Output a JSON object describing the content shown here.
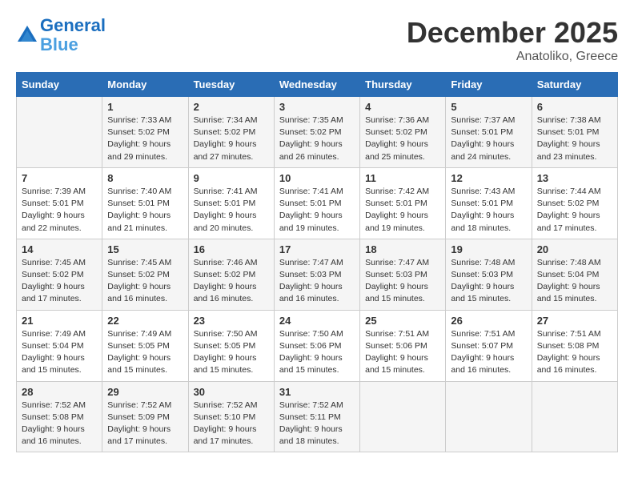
{
  "header": {
    "logo_line1": "General",
    "logo_line2": "Blue",
    "month": "December 2025",
    "location": "Anatoliko, Greece"
  },
  "days_of_week": [
    "Sunday",
    "Monday",
    "Tuesday",
    "Wednesday",
    "Thursday",
    "Friday",
    "Saturday"
  ],
  "weeks": [
    [
      {
        "day": "",
        "info": ""
      },
      {
        "day": "1",
        "info": "Sunrise: 7:33 AM\nSunset: 5:02 PM\nDaylight: 9 hours\nand 29 minutes."
      },
      {
        "day": "2",
        "info": "Sunrise: 7:34 AM\nSunset: 5:02 PM\nDaylight: 9 hours\nand 27 minutes."
      },
      {
        "day": "3",
        "info": "Sunrise: 7:35 AM\nSunset: 5:02 PM\nDaylight: 9 hours\nand 26 minutes."
      },
      {
        "day": "4",
        "info": "Sunrise: 7:36 AM\nSunset: 5:02 PM\nDaylight: 9 hours\nand 25 minutes."
      },
      {
        "day": "5",
        "info": "Sunrise: 7:37 AM\nSunset: 5:01 PM\nDaylight: 9 hours\nand 24 minutes."
      },
      {
        "day": "6",
        "info": "Sunrise: 7:38 AM\nSunset: 5:01 PM\nDaylight: 9 hours\nand 23 minutes."
      }
    ],
    [
      {
        "day": "7",
        "info": "Sunrise: 7:39 AM\nSunset: 5:01 PM\nDaylight: 9 hours\nand 22 minutes."
      },
      {
        "day": "8",
        "info": "Sunrise: 7:40 AM\nSunset: 5:01 PM\nDaylight: 9 hours\nand 21 minutes."
      },
      {
        "day": "9",
        "info": "Sunrise: 7:41 AM\nSunset: 5:01 PM\nDaylight: 9 hours\nand 20 minutes."
      },
      {
        "day": "10",
        "info": "Sunrise: 7:41 AM\nSunset: 5:01 PM\nDaylight: 9 hours\nand 19 minutes."
      },
      {
        "day": "11",
        "info": "Sunrise: 7:42 AM\nSunset: 5:01 PM\nDaylight: 9 hours\nand 19 minutes."
      },
      {
        "day": "12",
        "info": "Sunrise: 7:43 AM\nSunset: 5:01 PM\nDaylight: 9 hours\nand 18 minutes."
      },
      {
        "day": "13",
        "info": "Sunrise: 7:44 AM\nSunset: 5:02 PM\nDaylight: 9 hours\nand 17 minutes."
      }
    ],
    [
      {
        "day": "14",
        "info": "Sunrise: 7:45 AM\nSunset: 5:02 PM\nDaylight: 9 hours\nand 17 minutes."
      },
      {
        "day": "15",
        "info": "Sunrise: 7:45 AM\nSunset: 5:02 PM\nDaylight: 9 hours\nand 16 minutes."
      },
      {
        "day": "16",
        "info": "Sunrise: 7:46 AM\nSunset: 5:02 PM\nDaylight: 9 hours\nand 16 minutes."
      },
      {
        "day": "17",
        "info": "Sunrise: 7:47 AM\nSunset: 5:03 PM\nDaylight: 9 hours\nand 16 minutes."
      },
      {
        "day": "18",
        "info": "Sunrise: 7:47 AM\nSunset: 5:03 PM\nDaylight: 9 hours\nand 15 minutes."
      },
      {
        "day": "19",
        "info": "Sunrise: 7:48 AM\nSunset: 5:03 PM\nDaylight: 9 hours\nand 15 minutes."
      },
      {
        "day": "20",
        "info": "Sunrise: 7:48 AM\nSunset: 5:04 PM\nDaylight: 9 hours\nand 15 minutes."
      }
    ],
    [
      {
        "day": "21",
        "info": "Sunrise: 7:49 AM\nSunset: 5:04 PM\nDaylight: 9 hours\nand 15 minutes."
      },
      {
        "day": "22",
        "info": "Sunrise: 7:49 AM\nSunset: 5:05 PM\nDaylight: 9 hours\nand 15 minutes."
      },
      {
        "day": "23",
        "info": "Sunrise: 7:50 AM\nSunset: 5:05 PM\nDaylight: 9 hours\nand 15 minutes."
      },
      {
        "day": "24",
        "info": "Sunrise: 7:50 AM\nSunset: 5:06 PM\nDaylight: 9 hours\nand 15 minutes."
      },
      {
        "day": "25",
        "info": "Sunrise: 7:51 AM\nSunset: 5:06 PM\nDaylight: 9 hours\nand 15 minutes."
      },
      {
        "day": "26",
        "info": "Sunrise: 7:51 AM\nSunset: 5:07 PM\nDaylight: 9 hours\nand 16 minutes."
      },
      {
        "day": "27",
        "info": "Sunrise: 7:51 AM\nSunset: 5:08 PM\nDaylight: 9 hours\nand 16 minutes."
      }
    ],
    [
      {
        "day": "28",
        "info": "Sunrise: 7:52 AM\nSunset: 5:08 PM\nDaylight: 9 hours\nand 16 minutes."
      },
      {
        "day": "29",
        "info": "Sunrise: 7:52 AM\nSunset: 5:09 PM\nDaylight: 9 hours\nand 17 minutes."
      },
      {
        "day": "30",
        "info": "Sunrise: 7:52 AM\nSunset: 5:10 PM\nDaylight: 9 hours\nand 17 minutes."
      },
      {
        "day": "31",
        "info": "Sunrise: 7:52 AM\nSunset: 5:11 PM\nDaylight: 9 hours\nand 18 minutes."
      },
      {
        "day": "",
        "info": ""
      },
      {
        "day": "",
        "info": ""
      },
      {
        "day": "",
        "info": ""
      }
    ]
  ]
}
